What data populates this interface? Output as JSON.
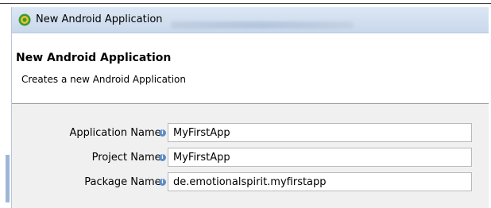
{
  "window": {
    "title": "New Android Application"
  },
  "header": {
    "title": "New Android Application",
    "description": "Creates a new Android Application"
  },
  "form": {
    "fields": [
      {
        "label": "Application Name:",
        "value": "MyFirstApp"
      },
      {
        "label": "Project Name:",
        "value": "MyFirstApp"
      },
      {
        "label": "Package Name:",
        "value": "de.emotionalspirit.myfirstapp"
      }
    ]
  },
  "colors": {
    "titlebar": "#dce7f4",
    "form_background": "#f0f0f0",
    "info_icon": "#5f8bc6",
    "app_icon": "#3c9a2f"
  },
  "icons": {
    "app": "android-app-icon",
    "info": "info-icon"
  }
}
